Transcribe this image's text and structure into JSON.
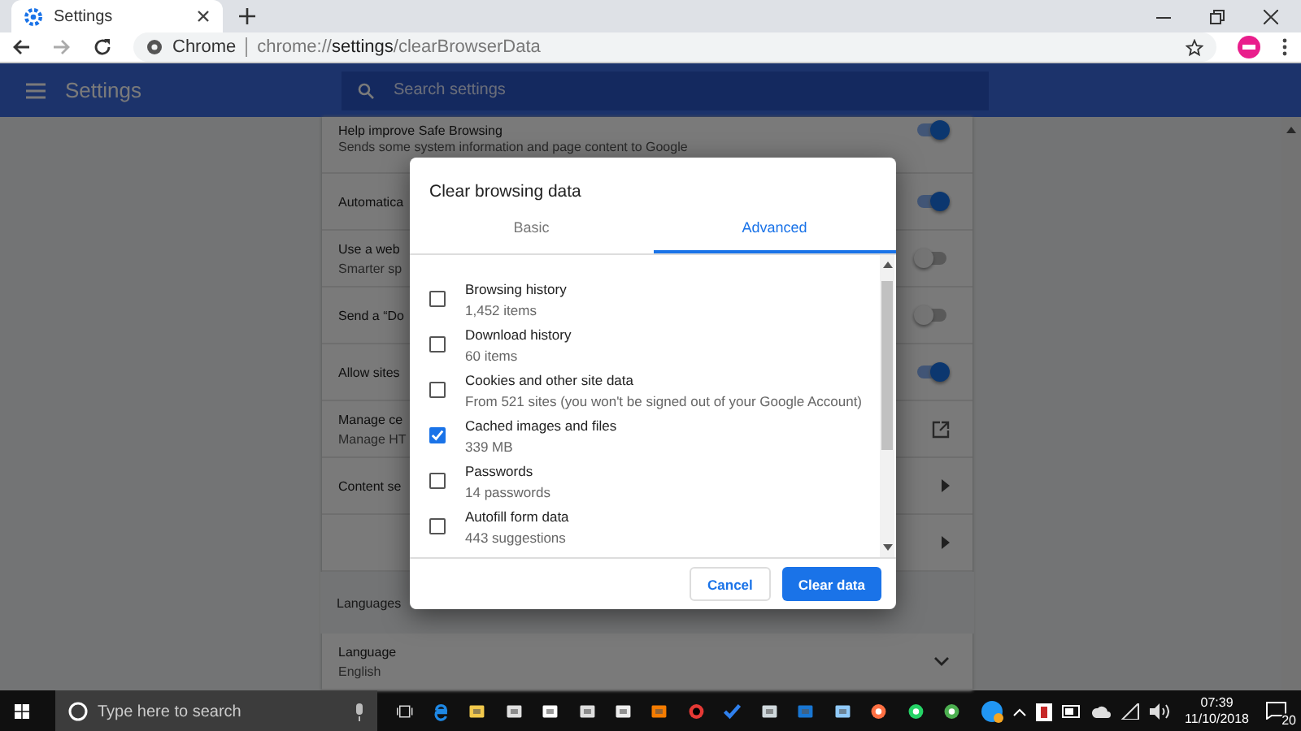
{
  "browser": {
    "tab_title": "Settings",
    "site_label": "Chrome",
    "url_scheme": "chrome://",
    "url_host": "settings",
    "url_path": "/clearBrowserData"
  },
  "settings_header": {
    "title": "Settings",
    "search_placeholder": "Search settings"
  },
  "settings_rows": [
    {
      "kind": "toggle",
      "title": "Help improve Safe Browsing",
      "subtitle": "Sends some system information and page content to Google",
      "on": true
    },
    {
      "kind": "toggle",
      "title": "Automatica",
      "on": true
    },
    {
      "kind": "toggle",
      "title": "Use a web",
      "subtitle": "Smarter sp",
      "on": false
    },
    {
      "kind": "toggle",
      "title": "Send a “Do",
      "on": false
    },
    {
      "kind": "toggle",
      "title": "Allow sites",
      "on": true
    },
    {
      "kind": "external",
      "title": "Manage ce",
      "subtitle": "Manage HT"
    },
    {
      "kind": "arrow",
      "title": "Content se"
    },
    {
      "kind": "arrow"
    },
    {
      "kind": "heading",
      "title": "Languages"
    },
    {
      "kind": "expand",
      "title": "Language",
      "subtitle": "English"
    }
  ],
  "dialog": {
    "title": "Clear browsing data",
    "tabs": [
      {
        "label": "Basic",
        "selected": false
      },
      {
        "label": "Advanced",
        "selected": true
      }
    ],
    "items": [
      {
        "label": "Browsing history",
        "detail": "1,452 items",
        "checked": false
      },
      {
        "label": "Download history",
        "detail": "60 items",
        "checked": false
      },
      {
        "label": "Cookies and other site data",
        "detail": "From 521 sites (you won't be signed out of your Google Account)",
        "checked": false
      },
      {
        "label": "Cached images and files",
        "detail": "339 MB",
        "checked": true
      },
      {
        "label": "Passwords",
        "detail": "14 passwords",
        "checked": false
      },
      {
        "label": "Autofill form data",
        "detail": "443 suggestions",
        "checked": false
      }
    ],
    "buttons": [
      {
        "label": "Cancel",
        "kind": "secondary"
      },
      {
        "label": "Clear data",
        "kind": "primary"
      }
    ]
  },
  "taskbar": {
    "search_placeholder": "Type here to search",
    "time": "07:39",
    "date": "11/10/2018",
    "notification_count": "20"
  }
}
